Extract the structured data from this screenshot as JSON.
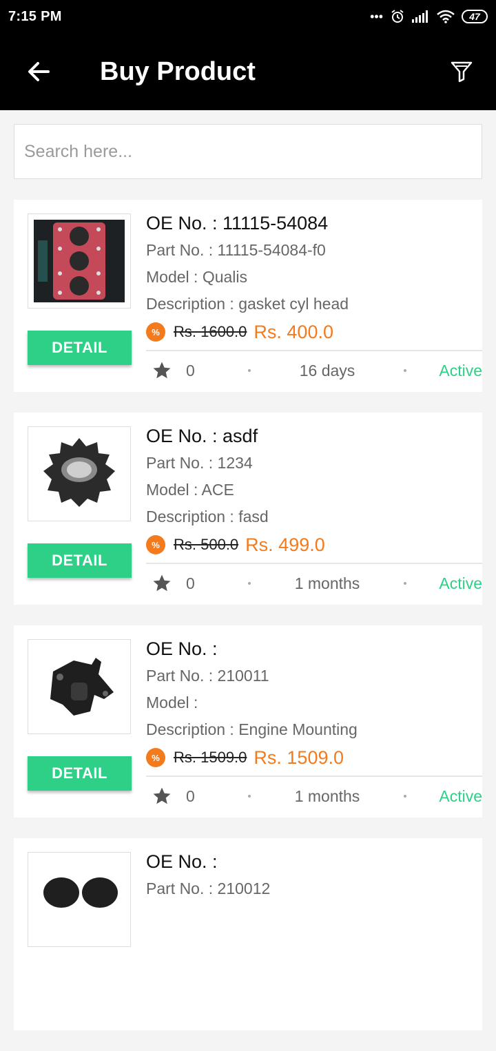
{
  "status_bar": {
    "time": "7:15 PM",
    "battery": "47"
  },
  "app_bar": {
    "title": "Buy Product",
    "back_icon": "arrow-left-icon",
    "filter_icon": "filter-icon"
  },
  "search": {
    "placeholder": "Search here...",
    "value": ""
  },
  "colors": {
    "accent_green": "#2ecf86",
    "price_orange": "#f37b1d",
    "app_bar_bg": "#000000"
  },
  "products": [
    {
      "oe": "OE No. : 11115-54084",
      "part": "Part No. :  11115-54084-f0",
      "model": "Model :  Qualis",
      "description": "Description :  gasket cyl head",
      "badge": "%",
      "old_price": "Rs. 1600.0",
      "new_price": "Rs. 400.0",
      "rating": "0",
      "time": "16 days",
      "status": "Active",
      "detail_label": "DETAIL",
      "image": "gasket-image"
    },
    {
      "oe": "OE No. : asdf",
      "part": "Part No. :  1234",
      "model": "Model :  ACE",
      "description": "Description :  fasd",
      "badge": "%",
      "old_price": "Rs. 500.0",
      "new_price": "Rs. 499.0",
      "rating": "0",
      "time": "1 months",
      "status": "Active",
      "detail_label": "DETAIL",
      "image": "gear-image"
    },
    {
      "oe": "OE No. :",
      "part": "Part No. :  210011",
      "model": "Model :",
      "description": "Description :  Engine Mounting",
      "badge": "%",
      "old_price": "Rs. 1509.0",
      "new_price": "Rs. 1509.0",
      "rating": "0",
      "time": "1 months",
      "status": "Active",
      "detail_label": "DETAIL",
      "image": "engine-mount-image"
    },
    {
      "oe": "OE No. :",
      "part": "Part No. :  210012",
      "model": "",
      "description": "",
      "badge": "",
      "old_price": "",
      "new_price": "",
      "rating": "",
      "time": "",
      "status": "",
      "detail_label": "",
      "image": "part-image"
    }
  ]
}
